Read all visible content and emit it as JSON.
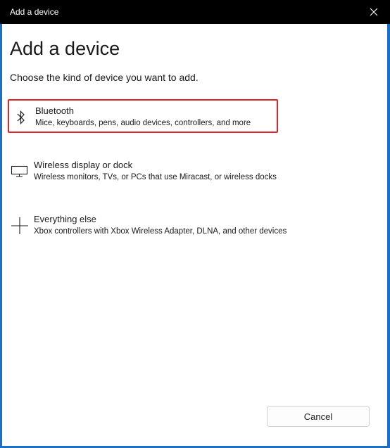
{
  "window": {
    "title": "Add a device"
  },
  "dialog": {
    "heading": "Add a device",
    "subheading": "Choose the kind of device you want to add."
  },
  "options": [
    {
      "icon": "bluetooth-icon",
      "title": "Bluetooth",
      "description": "Mice, keyboards, pens, audio devices, controllers, and more"
    },
    {
      "icon": "monitor-icon",
      "title": "Wireless display or dock",
      "description": "Wireless monitors, TVs, or PCs that use Miracast, or wireless docks"
    },
    {
      "icon": "plus-icon",
      "title": "Everything else",
      "description": "Xbox controllers with Xbox Wireless Adapter, DLNA, and other devices"
    }
  ],
  "footer": {
    "cancel_label": "Cancel"
  },
  "colors": {
    "highlight_border": "#e02424",
    "titlebar": "#000000",
    "window_border": "#1d6fc4"
  }
}
